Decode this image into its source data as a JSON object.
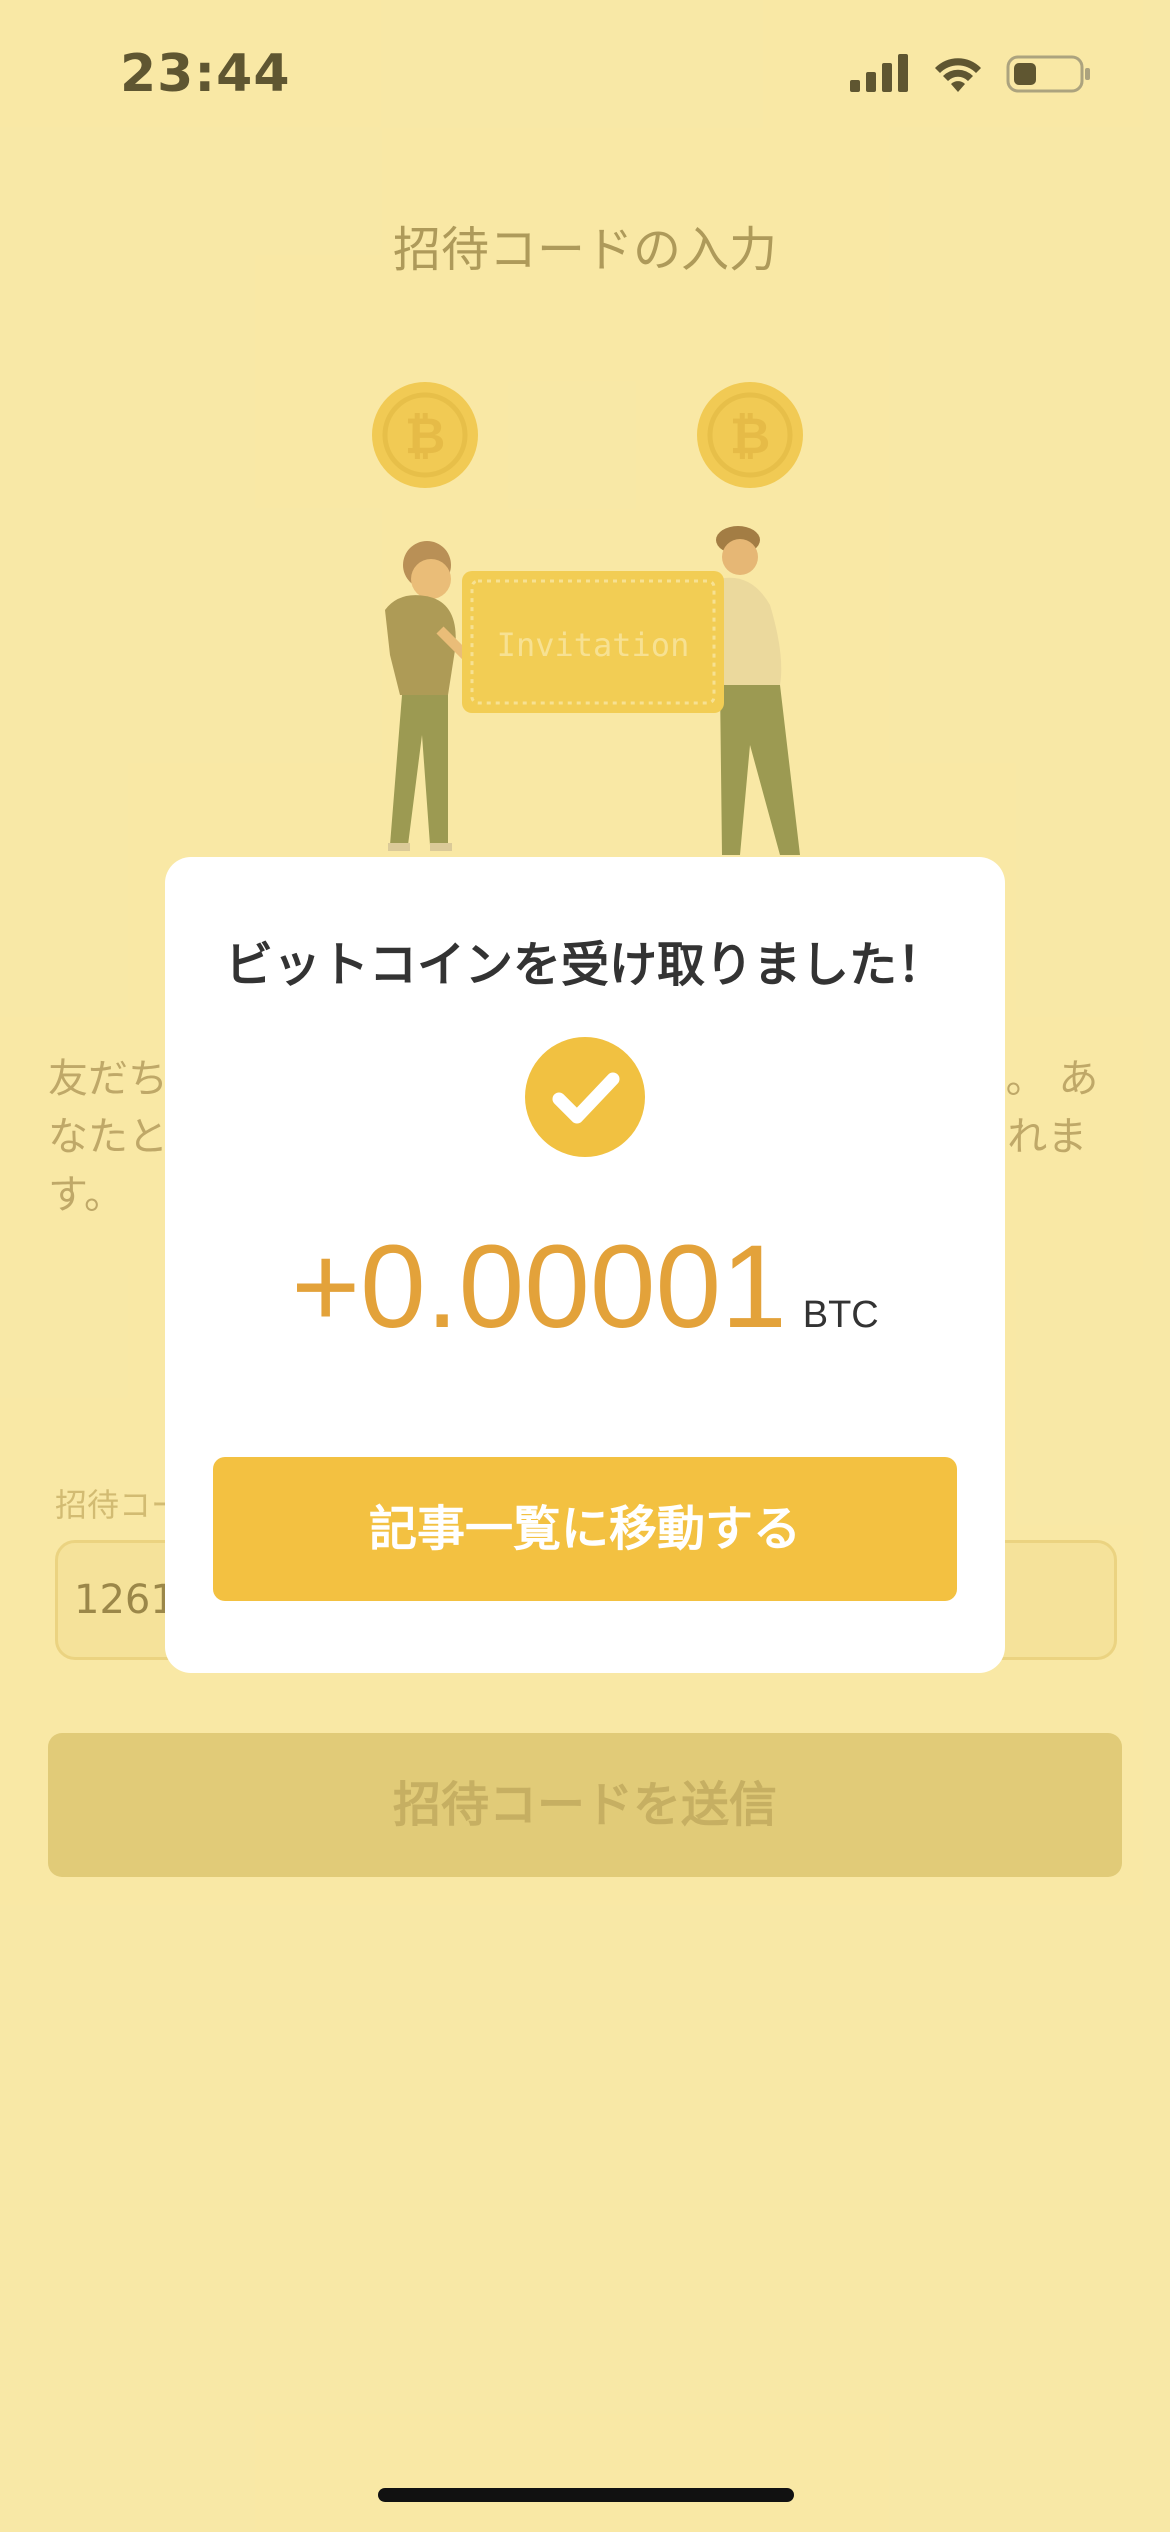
{
  "status_bar": {
    "time": "23:44"
  },
  "page": {
    "title": "招待コードの入力",
    "illustration_card_text": "Invitation",
    "description": "友だちから受け取った招待コードを入力してください。 あなたと友だちにそれぞれビットコインがプレゼントされます。",
    "field_label": "招待コード",
    "code_value": "1261",
    "submit_label": "招待コードを送信"
  },
  "modal": {
    "title": "ビットコインを受け取りました！",
    "amount": "+0.00001",
    "unit": "BTC",
    "button_label": "記事一覧に移動する"
  },
  "colors": {
    "accent": "#f3c141",
    "amount": "#e3a23a",
    "background": "#fdf1c4"
  }
}
